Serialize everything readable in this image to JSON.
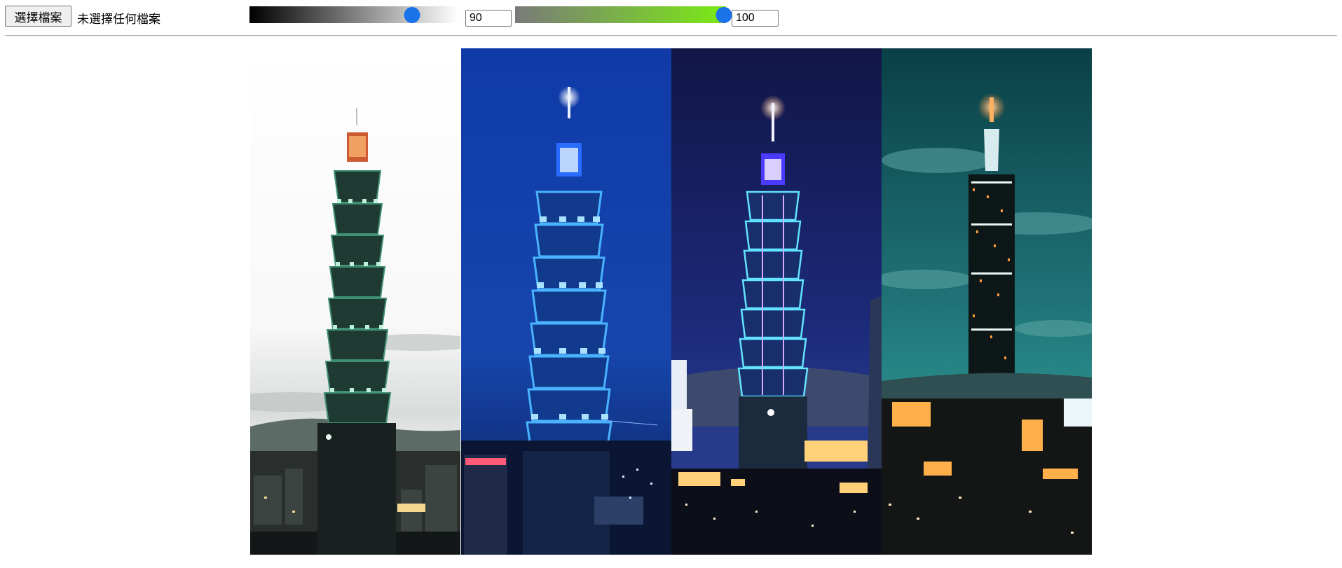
{
  "file_picker": {
    "button_label": "選擇檔案",
    "status_text": "未選擇任何檔案"
  },
  "brightness": {
    "value": "90",
    "fraction": 0.78,
    "gradient_from": "#000000",
    "gradient_to": "#ffffff"
  },
  "saturation": {
    "value": "100",
    "fraction": 0.99,
    "gradient_from": "#7a7a7a",
    "gradient_to": "#7bea14"
  },
  "colors": {
    "slider_thumb": "#1a73e8"
  },
  "photos": [
    {
      "subject": "taipei-101-tower-day-cloudy-sky"
    },
    {
      "subject": "taipei-101-tower-blue-night"
    },
    {
      "subject": "taipei-101-tower-purple-night"
    },
    {
      "subject": "taipei-101-tower-teal-long-exposure"
    }
  ]
}
